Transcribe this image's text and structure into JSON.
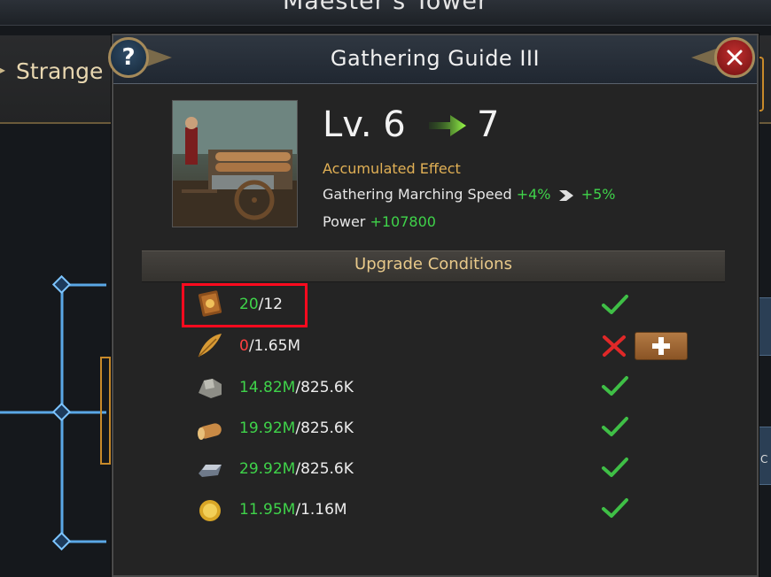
{
  "background": {
    "title": "Maester's Tower",
    "left_label": "Strange"
  },
  "dialog": {
    "title": "Gathering Guide III",
    "help_symbol": "?",
    "level": {
      "current": "Lv. 6",
      "next": "7"
    },
    "effect": {
      "label": "Accumulated Effect",
      "stat_name": "Gathering Marching Speed",
      "current_value": "+4%",
      "next_value": "+5%"
    },
    "power": {
      "label": "Power",
      "value": "+107800"
    },
    "conditions": {
      "title": "Upgrade Conditions",
      "rows": [
        {
          "icon": "book-icon",
          "have": "20",
          "need": "/12",
          "met": true
        },
        {
          "icon": "feather-icon",
          "have": "0",
          "need": "/1.65M",
          "met": false
        },
        {
          "icon": "stone-icon",
          "have": "14.82M",
          "need": "/825.6K",
          "met": true
        },
        {
          "icon": "wood-log-icon",
          "have": "19.92M",
          "need": "/825.6K",
          "met": true
        },
        {
          "icon": "iron-ingot-icon",
          "have": "29.92M",
          "need": "/825.6K",
          "met": true
        },
        {
          "icon": "gold-coin-icon",
          "have": "11.95M",
          "need": "/1.16M",
          "met": true
        }
      ]
    }
  },
  "colors": {
    "met": "#3fd34a",
    "unmet": "#ff4040",
    "accent_gold": "#e1b055",
    "highlight": "#ff0a1e"
  }
}
